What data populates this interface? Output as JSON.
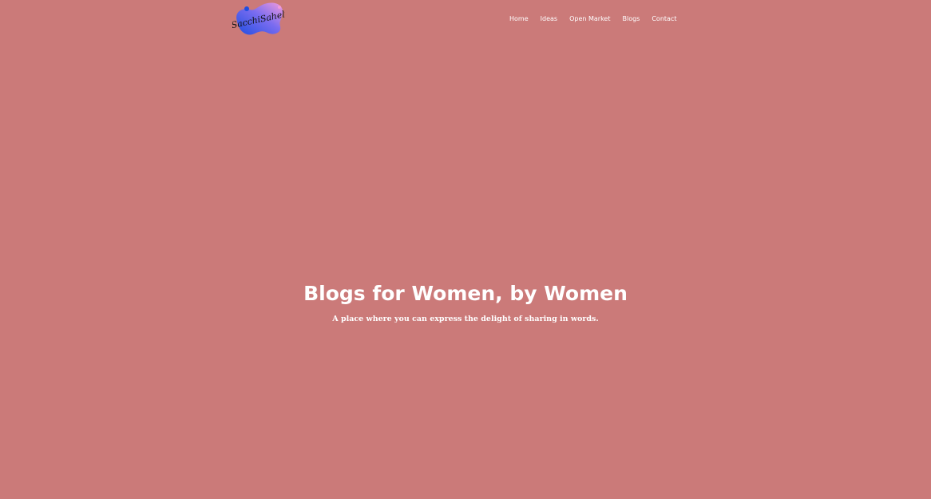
{
  "theme": {
    "background": "#cb7a79",
    "text": "#ffffff",
    "logo_gradient_start": "#1f4ee0",
    "logo_gradient_end": "#f19adc"
  },
  "header": {
    "logo": {
      "text": "SacchiSaheli",
      "icon": "logo-blob-icon"
    },
    "nav": [
      {
        "label": "Home"
      },
      {
        "label": "Ideas"
      },
      {
        "label": "Open Market"
      },
      {
        "label": "Blogs"
      },
      {
        "label": "Contact"
      }
    ]
  },
  "hero": {
    "title": "Blogs for Women, by Women",
    "subtitle": "A place where you can express the delight of sharing in words."
  }
}
